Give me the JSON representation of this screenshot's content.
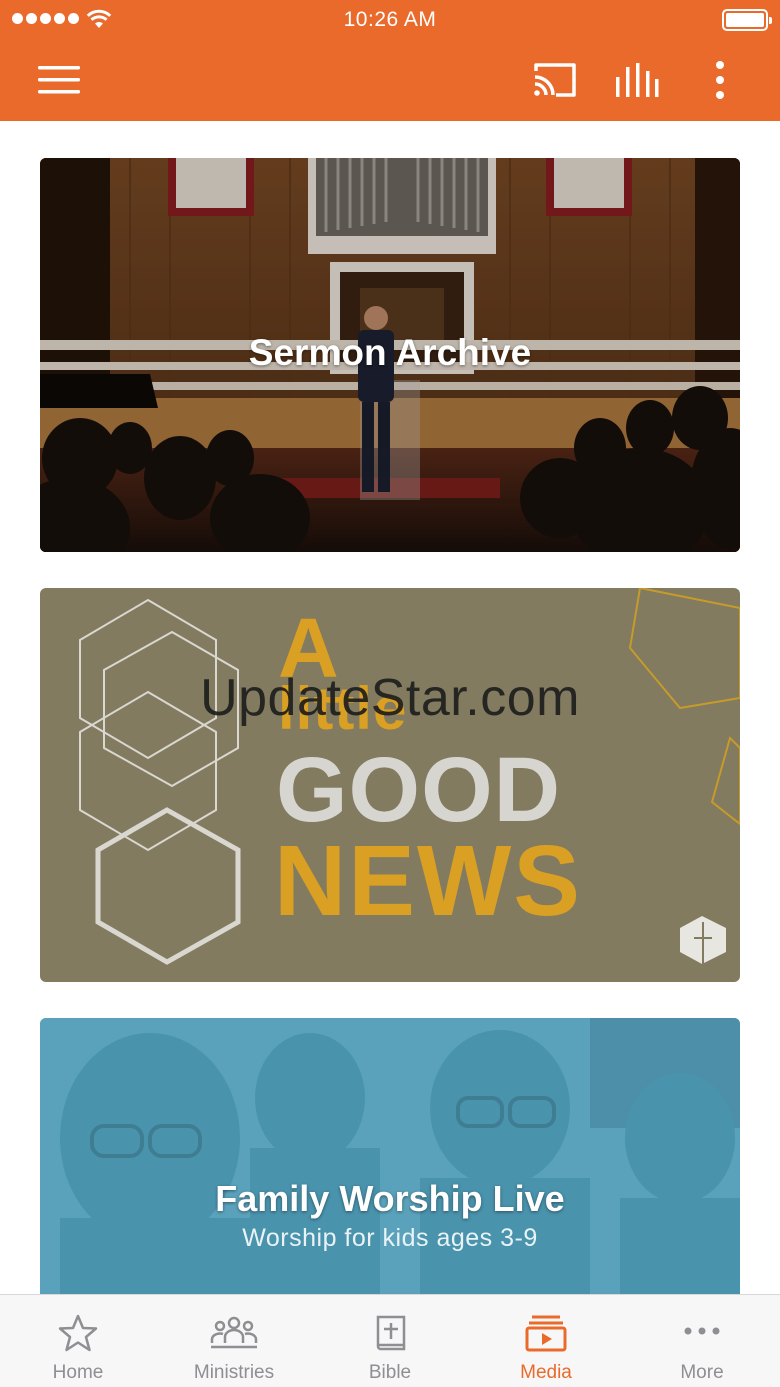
{
  "status_bar": {
    "time": "10:26 AM"
  },
  "app_bar": {
    "background": "#EA6A2C",
    "icons": [
      "menu-icon",
      "cast-icon",
      "bar-chart-icon",
      "more-vertical-icon"
    ]
  },
  "cards": [
    {
      "title": "Sermon Archive"
    },
    {
      "graphic_text": {
        "line1": "A",
        "line2": "little",
        "line3": "GOOD",
        "line4": "NEWS"
      }
    },
    {
      "title": "Family Worship Live",
      "subtitle": "Worship for kids ages 3-9"
    }
  ],
  "watermark": "UpdateStar.com",
  "tab_bar": {
    "accent": "#EA6A2C",
    "inactive_color": "#8e8e93",
    "selected": "Media",
    "tabs": [
      {
        "label": "Home",
        "icon": "star-icon"
      },
      {
        "label": "Ministries",
        "icon": "people-icon"
      },
      {
        "label": "Bible",
        "icon": "bible-icon"
      },
      {
        "label": "Media",
        "icon": "media-icon"
      },
      {
        "label": "More",
        "icon": "ellipsis-icon"
      }
    ]
  }
}
